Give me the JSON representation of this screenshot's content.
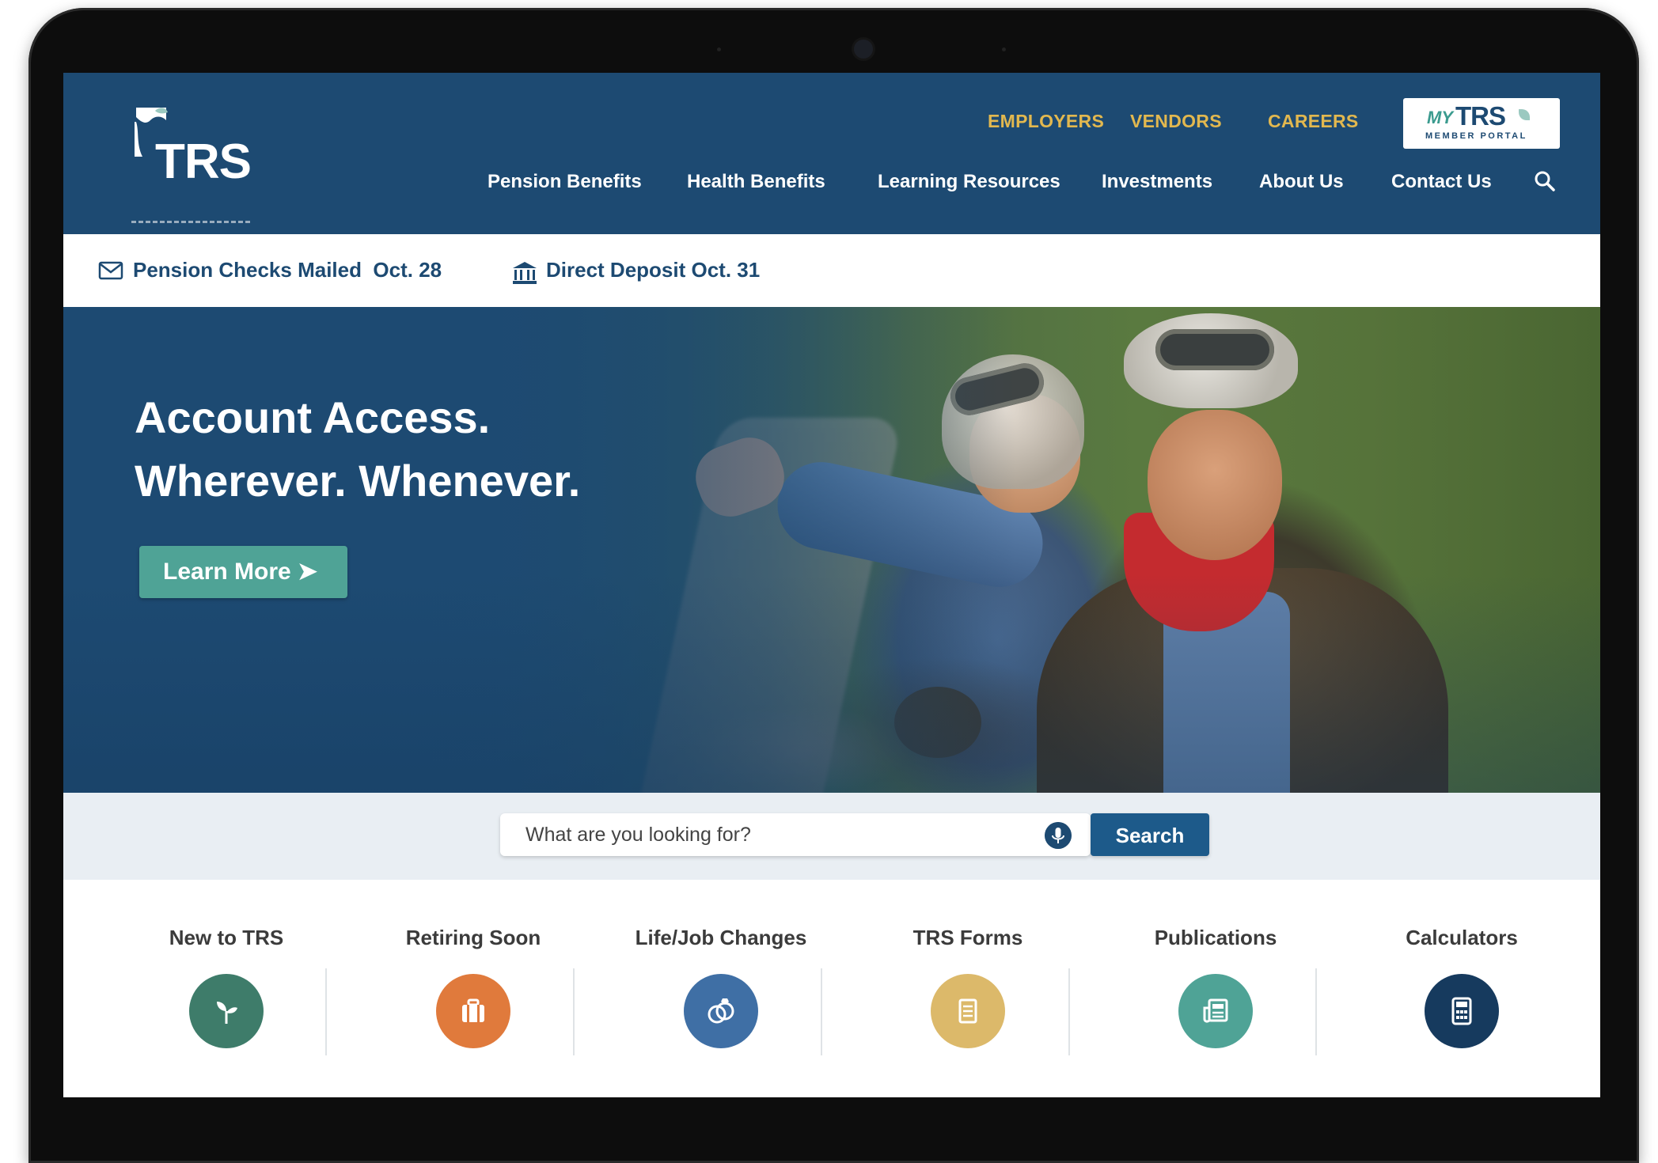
{
  "brand": {
    "logo_text": "TRS",
    "portal_my": "MY",
    "portal_trs": "TRS",
    "portal_sub": "MEMBER PORTAL"
  },
  "utility_nav": [
    {
      "label": "EMPLOYERS"
    },
    {
      "label": "VENDORS"
    },
    {
      "label": "CAREERS"
    }
  ],
  "main_nav": [
    {
      "label": "Pension Benefits"
    },
    {
      "label": "Health Benefits"
    },
    {
      "label": "Learning Resources"
    },
    {
      "label": "Investments"
    },
    {
      "label": "About Us"
    },
    {
      "label": "Contact Us"
    }
  ],
  "alerts": [
    {
      "text": "Pension Checks Mailed  Oct. 28",
      "icon": "mail-icon"
    },
    {
      "text": "Direct Deposit Oct. 31",
      "icon": "bank-icon"
    }
  ],
  "hero": {
    "line1": "Account Access.",
    "line2": "Wherever. Whenever.",
    "cta": "Learn More ➤"
  },
  "search": {
    "placeholder": "What are you looking for?",
    "button": "Search"
  },
  "quick_links": [
    {
      "label": "New to TRS",
      "icon": "sprout-icon",
      "color": "#3e7c6a"
    },
    {
      "label": "Retiring Soon",
      "icon": "suitcase-icon",
      "color": "#e07a3c"
    },
    {
      "label": "Life/Job Changes",
      "icon": "rings-icon",
      "color": "#3f6fa5"
    },
    {
      "label": "TRS Forms",
      "icon": "document-icon",
      "color": "#dcb96a"
    },
    {
      "label": "Publications",
      "icon": "newspaper-icon",
      "color": "#4fa396"
    },
    {
      "label": "Calculators",
      "icon": "calculator-icon",
      "color": "#163a5e"
    }
  ],
  "colors": {
    "primary": "#1d4a72",
    "accent_gold": "#e2b84f",
    "accent_teal": "#4fa396"
  }
}
